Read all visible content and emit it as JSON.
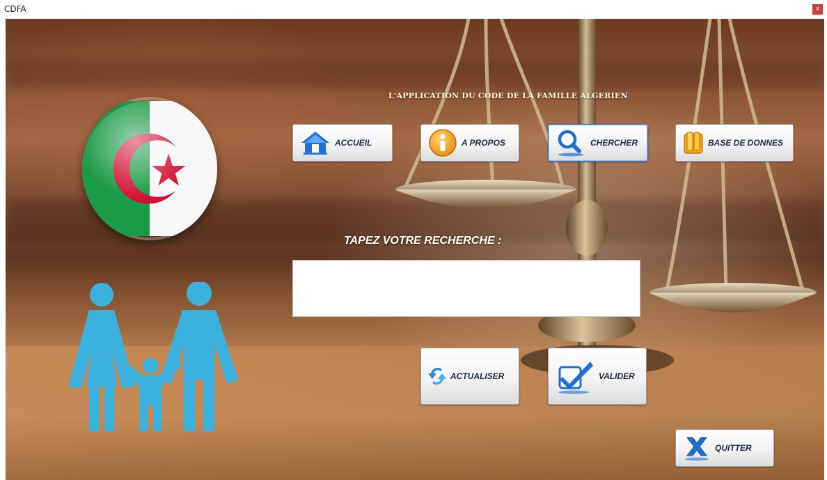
{
  "window": {
    "title": "CDFA",
    "close_label": "x"
  },
  "app_title": "L'APPLICATION DU CODE DE LA FAMILLE ALGERIEN",
  "nav": {
    "accueil": "ACCUEIL",
    "a_propos": "A PROPOS",
    "chercher": "CHERCHER",
    "base_de_donnes": "BASE DE DONNES"
  },
  "search": {
    "label": "TAPEZ VOTRE RECHERCHE :",
    "value": "",
    "placeholder": ""
  },
  "actions": {
    "actualiser": "ACTUALISER",
    "valider": "VALIDER",
    "quitter": "QUITTER"
  },
  "icons": {
    "accueil": "home-icon",
    "a_propos": "info-icon",
    "chercher": "search-icon",
    "base_de_donnes": "database-icon",
    "actualiser": "refresh-icon",
    "valider": "checkmark-icon",
    "quitter": "close-x-icon",
    "flag": "algeria-flag-icon",
    "family": "family-icon"
  },
  "colors": {
    "flag_green": "#1a9a46",
    "flag_red": "#d21034",
    "family_blue": "#3bb0dc",
    "button_text": "#1c2a4a",
    "icon_blue": "#1f6fd1"
  }
}
